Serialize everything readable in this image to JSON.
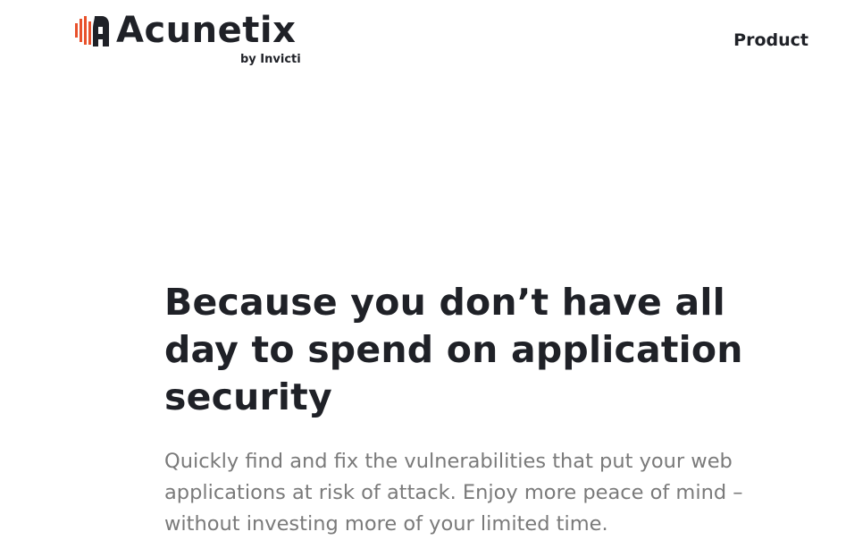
{
  "header": {
    "logo": {
      "wordmark": "Acunetix",
      "subtitle": "by Invicti",
      "icon": "acunetix-logo-mark-icon",
      "mark_color": "#e8512b"
    },
    "nav": {
      "product_label": "Product"
    }
  },
  "hero": {
    "title": "Because you don’t have all day to spend on application security",
    "description": "Quickly find and fix the vulnerabilities that put your web applications at risk of attack. Enjoy more peace of mind – without investing more of your limited time."
  },
  "colors": {
    "text_dark": "#1f2127",
    "text_muted": "#7a7a7a",
    "brand_orange": "#e8512b",
    "background": "#ffffff"
  }
}
